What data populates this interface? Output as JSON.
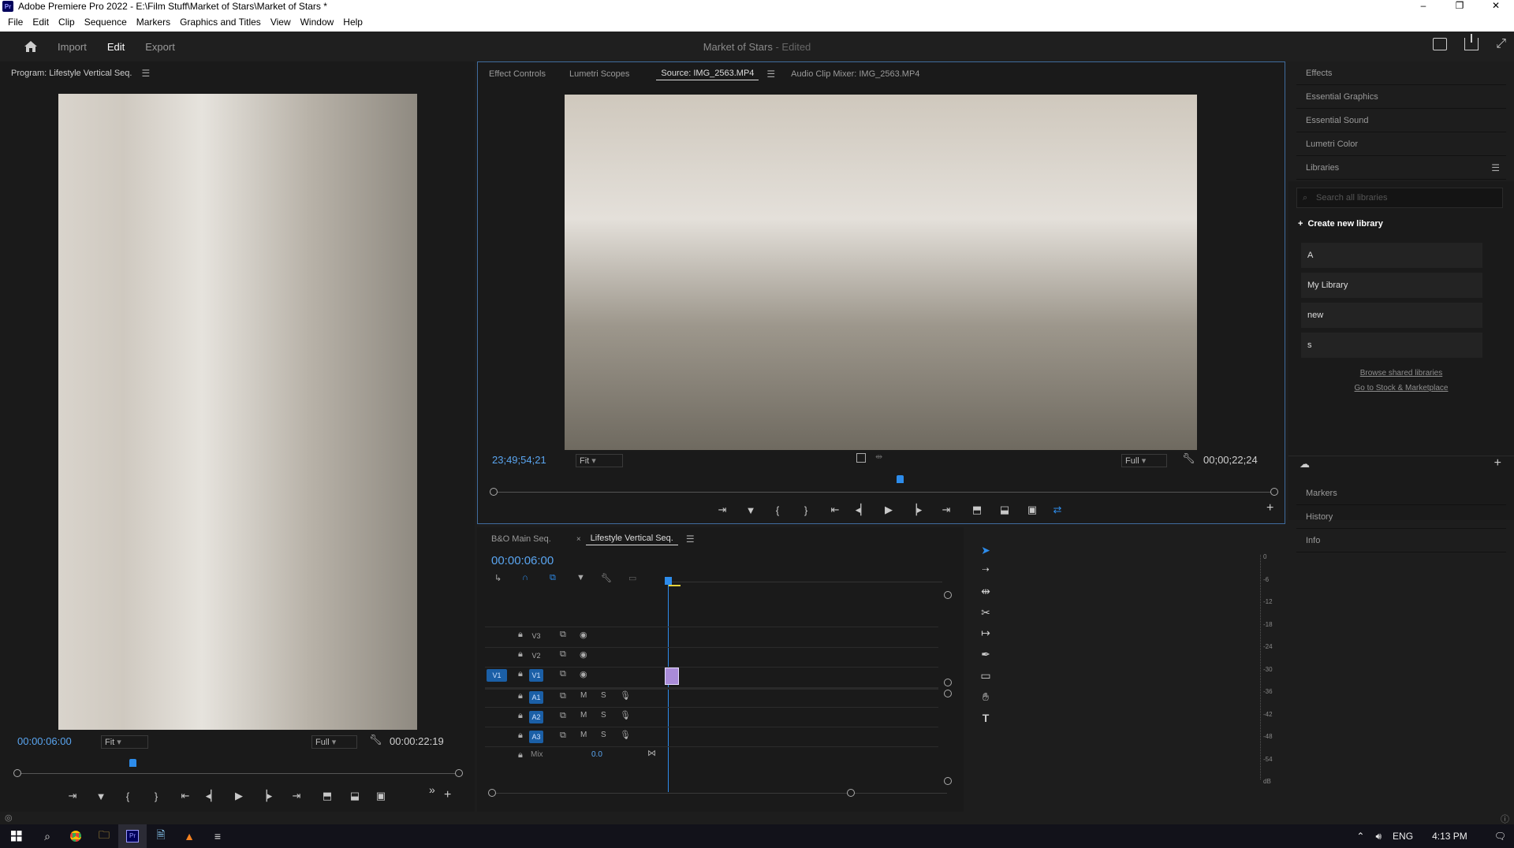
{
  "window": {
    "title": "Adobe Premiere Pro 2022 - E:\\Film Stuff\\Market of Stars\\Market of Stars *",
    "app_icon_label": "Pr",
    "controls": [
      "–",
      "❐",
      "✕"
    ]
  },
  "menu": [
    "File",
    "Edit",
    "Clip",
    "Sequence",
    "Markers",
    "Graphics and Titles",
    "View",
    "Window",
    "Help"
  ],
  "header": {
    "tabs": [
      "Import",
      "Edit",
      "Export"
    ],
    "active_tab": "Edit",
    "project_title": "Market of Stars",
    "project_status": " - Edited"
  },
  "program_monitor": {
    "title": "Program: Lifestyle Vertical Seq.",
    "timecode": "00:00:06:00",
    "zoom": "Fit",
    "resolution": "Full",
    "duration": "00:00:22:19",
    "playhead_fraction": 0.26
  },
  "source_monitor": {
    "tabs": [
      "Effect Controls",
      "Lumetri Scopes",
      "Source: IMG_2563.MP4",
      "Audio Clip Mixer: IMG_2563.MP4"
    ],
    "active_tab": "Source: IMG_2563.MP4",
    "timecode": "23;49;54;21",
    "zoom": "Fit",
    "resolution": "Full",
    "duration": "00;00;22;24",
    "playhead_fraction": 0.52
  },
  "right_panel": {
    "top_items": [
      "Effects",
      "Essential Graphics",
      "Essential Sound",
      "Lumetri Color",
      "Libraries"
    ],
    "search_placeholder": "Search all libraries",
    "create_library_label": "Create new library",
    "libraries": [
      "A",
      "My Library",
      "new",
      "s"
    ],
    "links": [
      "Browse shared libraries",
      "Go to Stock & Marketplace"
    ],
    "bottom_items": [
      "Markers",
      "History",
      "Info"
    ]
  },
  "timeline": {
    "tabs": [
      "B&O Main Seq.",
      "Lifestyle Vertical Seq."
    ],
    "active_tab": "Lifestyle Vertical Seq.",
    "timecode": "00:00:06:00",
    "video_tracks": [
      "V3",
      "V2",
      "V1"
    ],
    "audio_tracks": [
      "A1",
      "A2",
      "A3"
    ],
    "source_patch": "V1",
    "track_letters": {
      "mute": "M",
      "solo": "S"
    },
    "mix_label": "Mix",
    "mix_value": "0.0"
  },
  "audio_meter": {
    "labels": [
      "0",
      "-6",
      "-12",
      "-18",
      "-24",
      "-30",
      "-36",
      "-42",
      "-48",
      "-54",
      "dB"
    ]
  },
  "taskbar": {
    "lang": "ENG",
    "time": "4:13 PM"
  }
}
